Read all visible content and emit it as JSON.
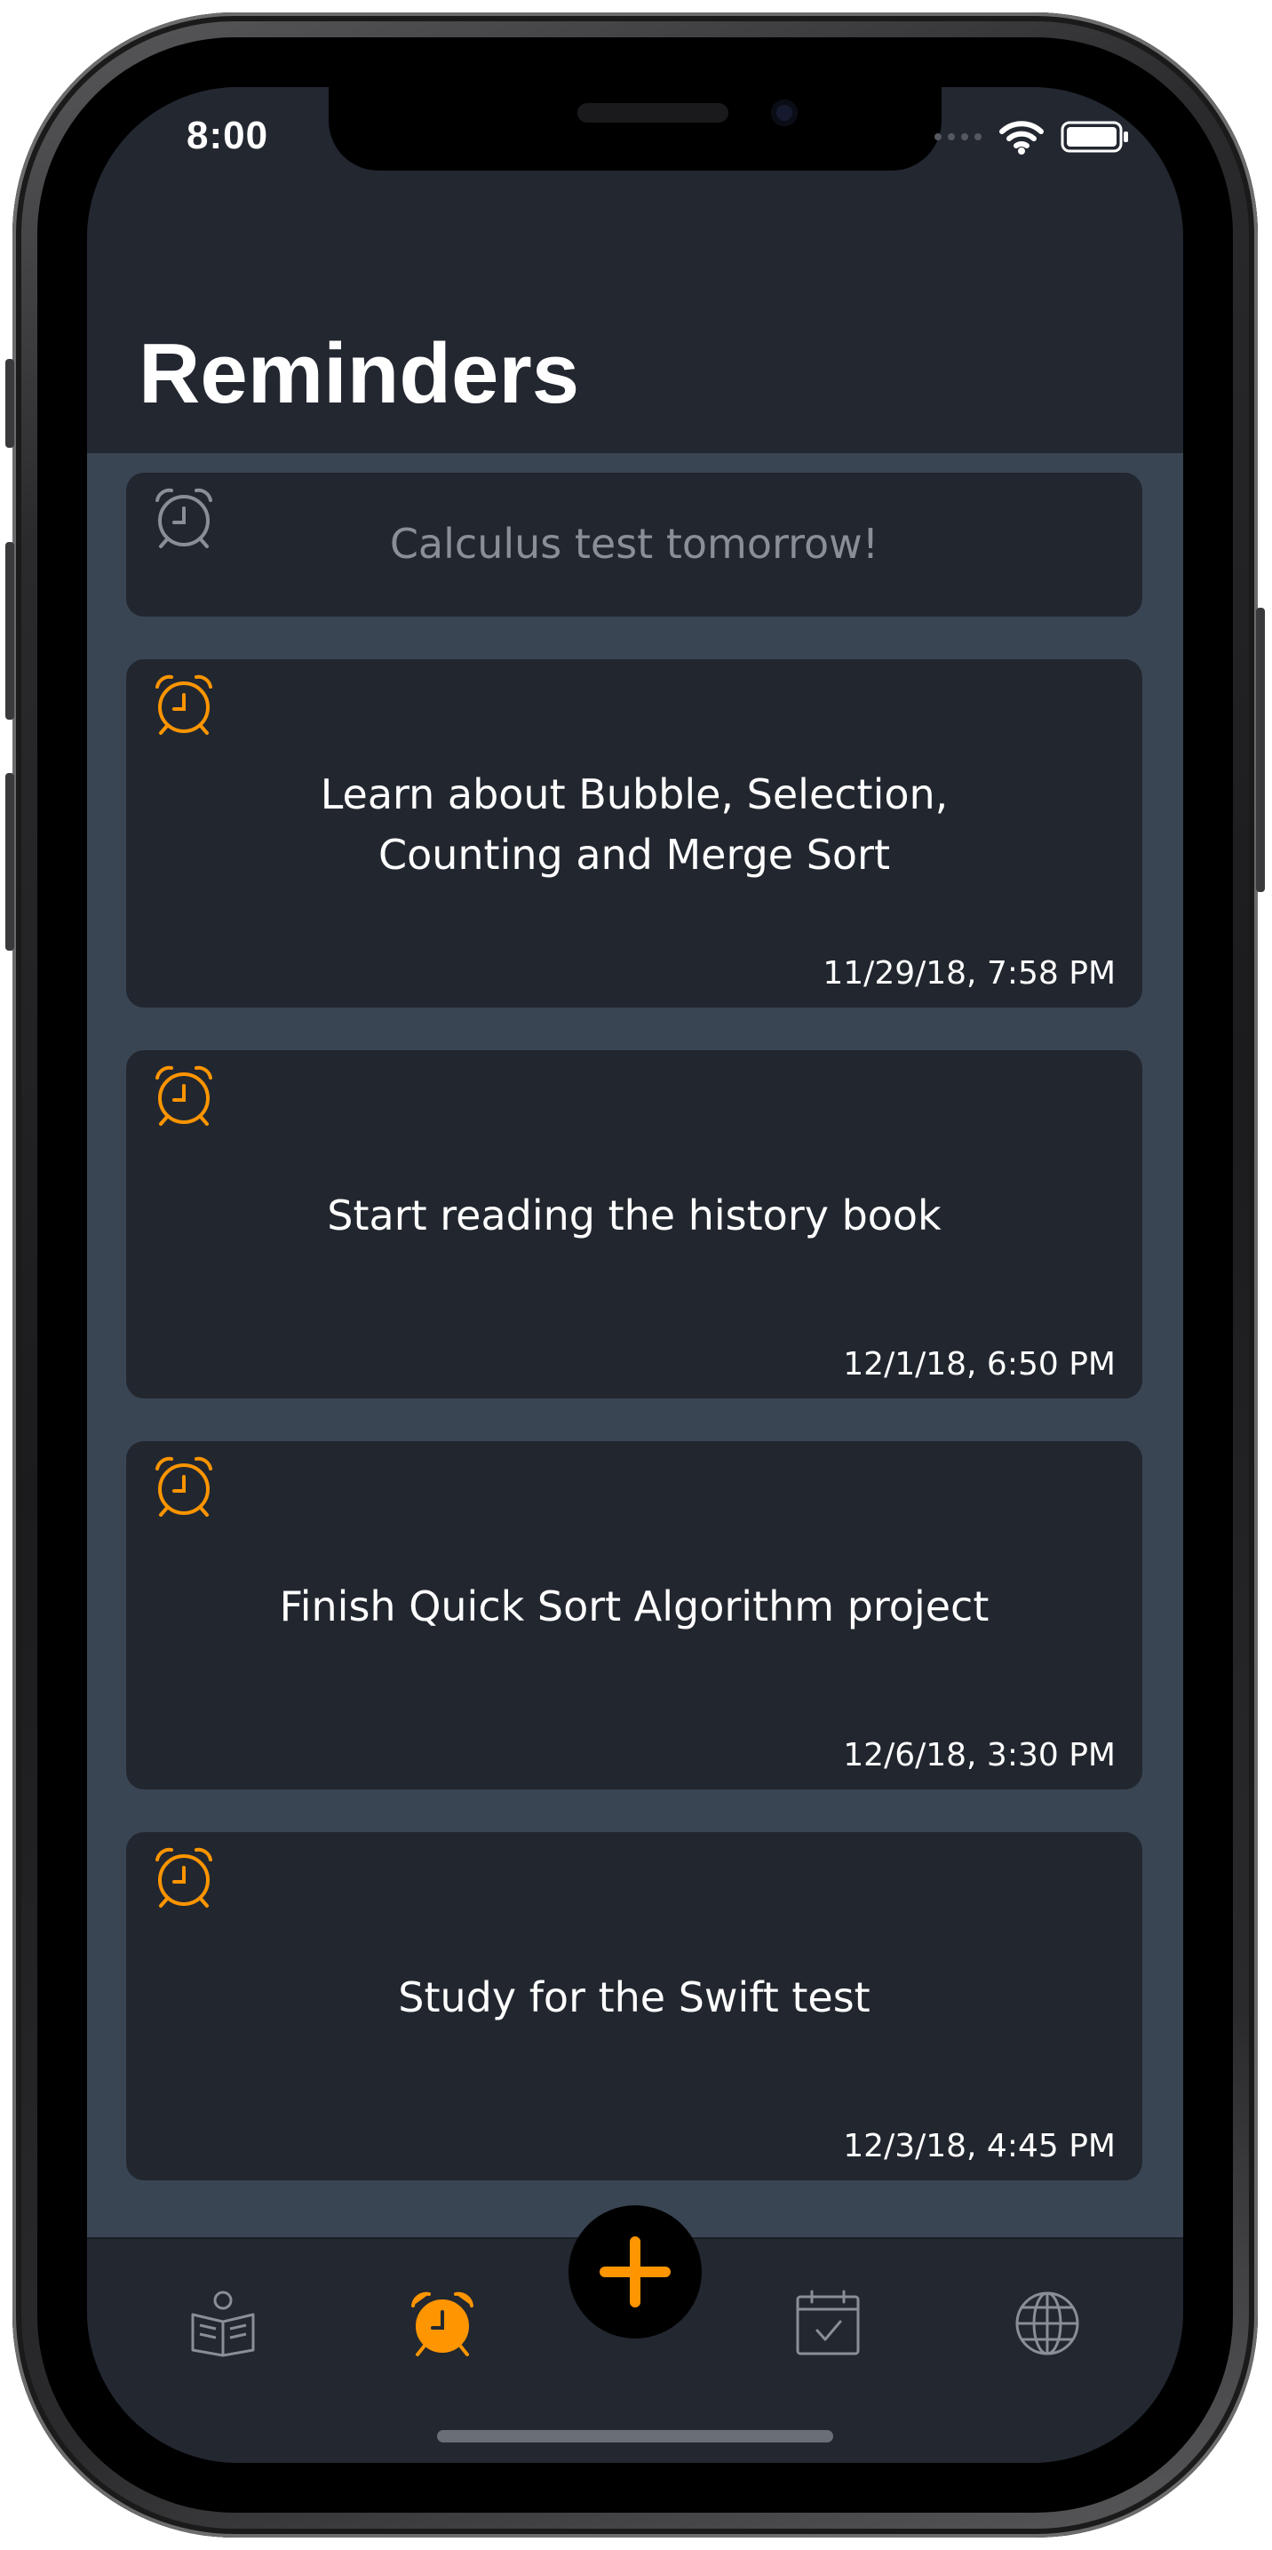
{
  "status_bar": {
    "time": "8:00",
    "wifi_icon": "wifi-icon",
    "battery_icon": "battery-icon"
  },
  "header": {
    "title": "Reminders"
  },
  "reminders": [
    {
      "title": "Calculus test tomorrow!",
      "date": "",
      "icon": "alarm-clock-icon",
      "icon_color": "#8a8f96",
      "active": false
    },
    {
      "title_line1": "Learn about Bubble, Selection,",
      "title_line2": "Counting and Merge Sort",
      "date": "11/29/18, 7:58 PM",
      "icon": "alarm-clock-icon",
      "icon_color": "#ff9500",
      "active": true
    },
    {
      "title": "Start reading the history book",
      "date": "12/1/18, 6:50 PM",
      "icon": "alarm-clock-icon",
      "icon_color": "#ff9500",
      "active": true
    },
    {
      "title": "Finish Quick Sort Algorithm project",
      "date": "12/6/18, 3:30 PM",
      "icon": "alarm-clock-icon",
      "icon_color": "#ff9500",
      "active": true
    },
    {
      "title": "Study for the Swift test",
      "date": "12/3/18, 4:45 PM",
      "icon": "alarm-clock-icon",
      "icon_color": "#ff9500",
      "active": true
    }
  ],
  "tab_bar": {
    "tabs": [
      {
        "icon": "reading-book-icon",
        "selected": false
      },
      {
        "icon": "alarm-clock-icon",
        "selected": true
      },
      {
        "icon": "calendar-check-icon",
        "selected": false
      },
      {
        "icon": "globe-icon",
        "selected": false
      }
    ],
    "add_button_icon": "plus-icon"
  },
  "colors": {
    "accent": "#ff9500",
    "background": "#222730",
    "list_background": "#3a4554",
    "card": "#22272f",
    "inactive_icon": "#8a8f96"
  }
}
